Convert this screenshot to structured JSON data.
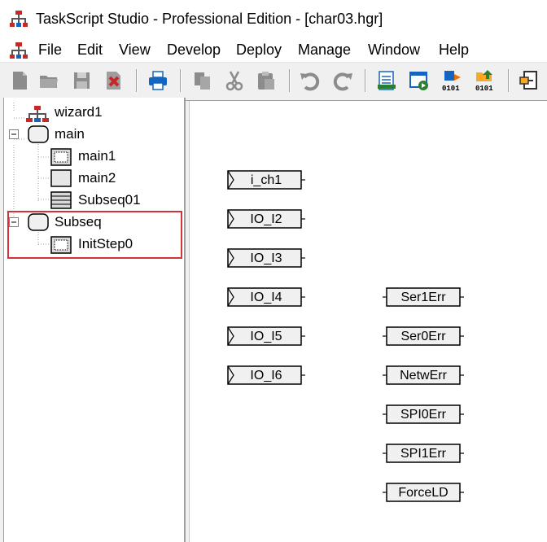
{
  "app": {
    "title": "TaskScript Studio - Professional Edition - [char03.hgr]"
  },
  "menu": {
    "items": [
      "File",
      "Edit",
      "View",
      "Develop",
      "Deploy",
      "Manage",
      "Window",
      "Help"
    ]
  },
  "toolbar": {
    "buttons": [
      "new-file-icon",
      "open-folder-icon",
      "save-icon",
      "close-file-icon",
      "print-icon",
      "copy-icon",
      "cut-icon",
      "paste-icon",
      "undo-icon",
      "redo-icon",
      "properties-icon",
      "run-icon",
      "download-binary-icon",
      "upload-binary-icon",
      "exit-icon"
    ]
  },
  "tree": {
    "items": [
      {
        "label": "wizard1",
        "icon": "wizard-network-icon"
      },
      {
        "label": "main",
        "icon": "task-node-icon",
        "expander": "⊟"
      },
      {
        "label": "main1",
        "icon": "step-icon"
      },
      {
        "label": "main2",
        "icon": "step-icon"
      },
      {
        "label": "Subseq01",
        "icon": "subsequence-icon"
      },
      {
        "label": "Subseq",
        "icon": "task-node-icon",
        "expander": "⊟"
      },
      {
        "label": "InitStep0",
        "icon": "step-icon"
      }
    ],
    "highlight_color": "#d13438"
  },
  "canvas": {
    "inputs": [
      "i_ch1",
      "IO_I2",
      "IO_I3",
      "IO_I4",
      "IO_I5",
      "IO_I6"
    ],
    "outputs": [
      "Ser1Err",
      "Ser0Err",
      "NetwErr",
      "SPI0Err",
      "SPI1Err",
      "ForceLD"
    ]
  }
}
